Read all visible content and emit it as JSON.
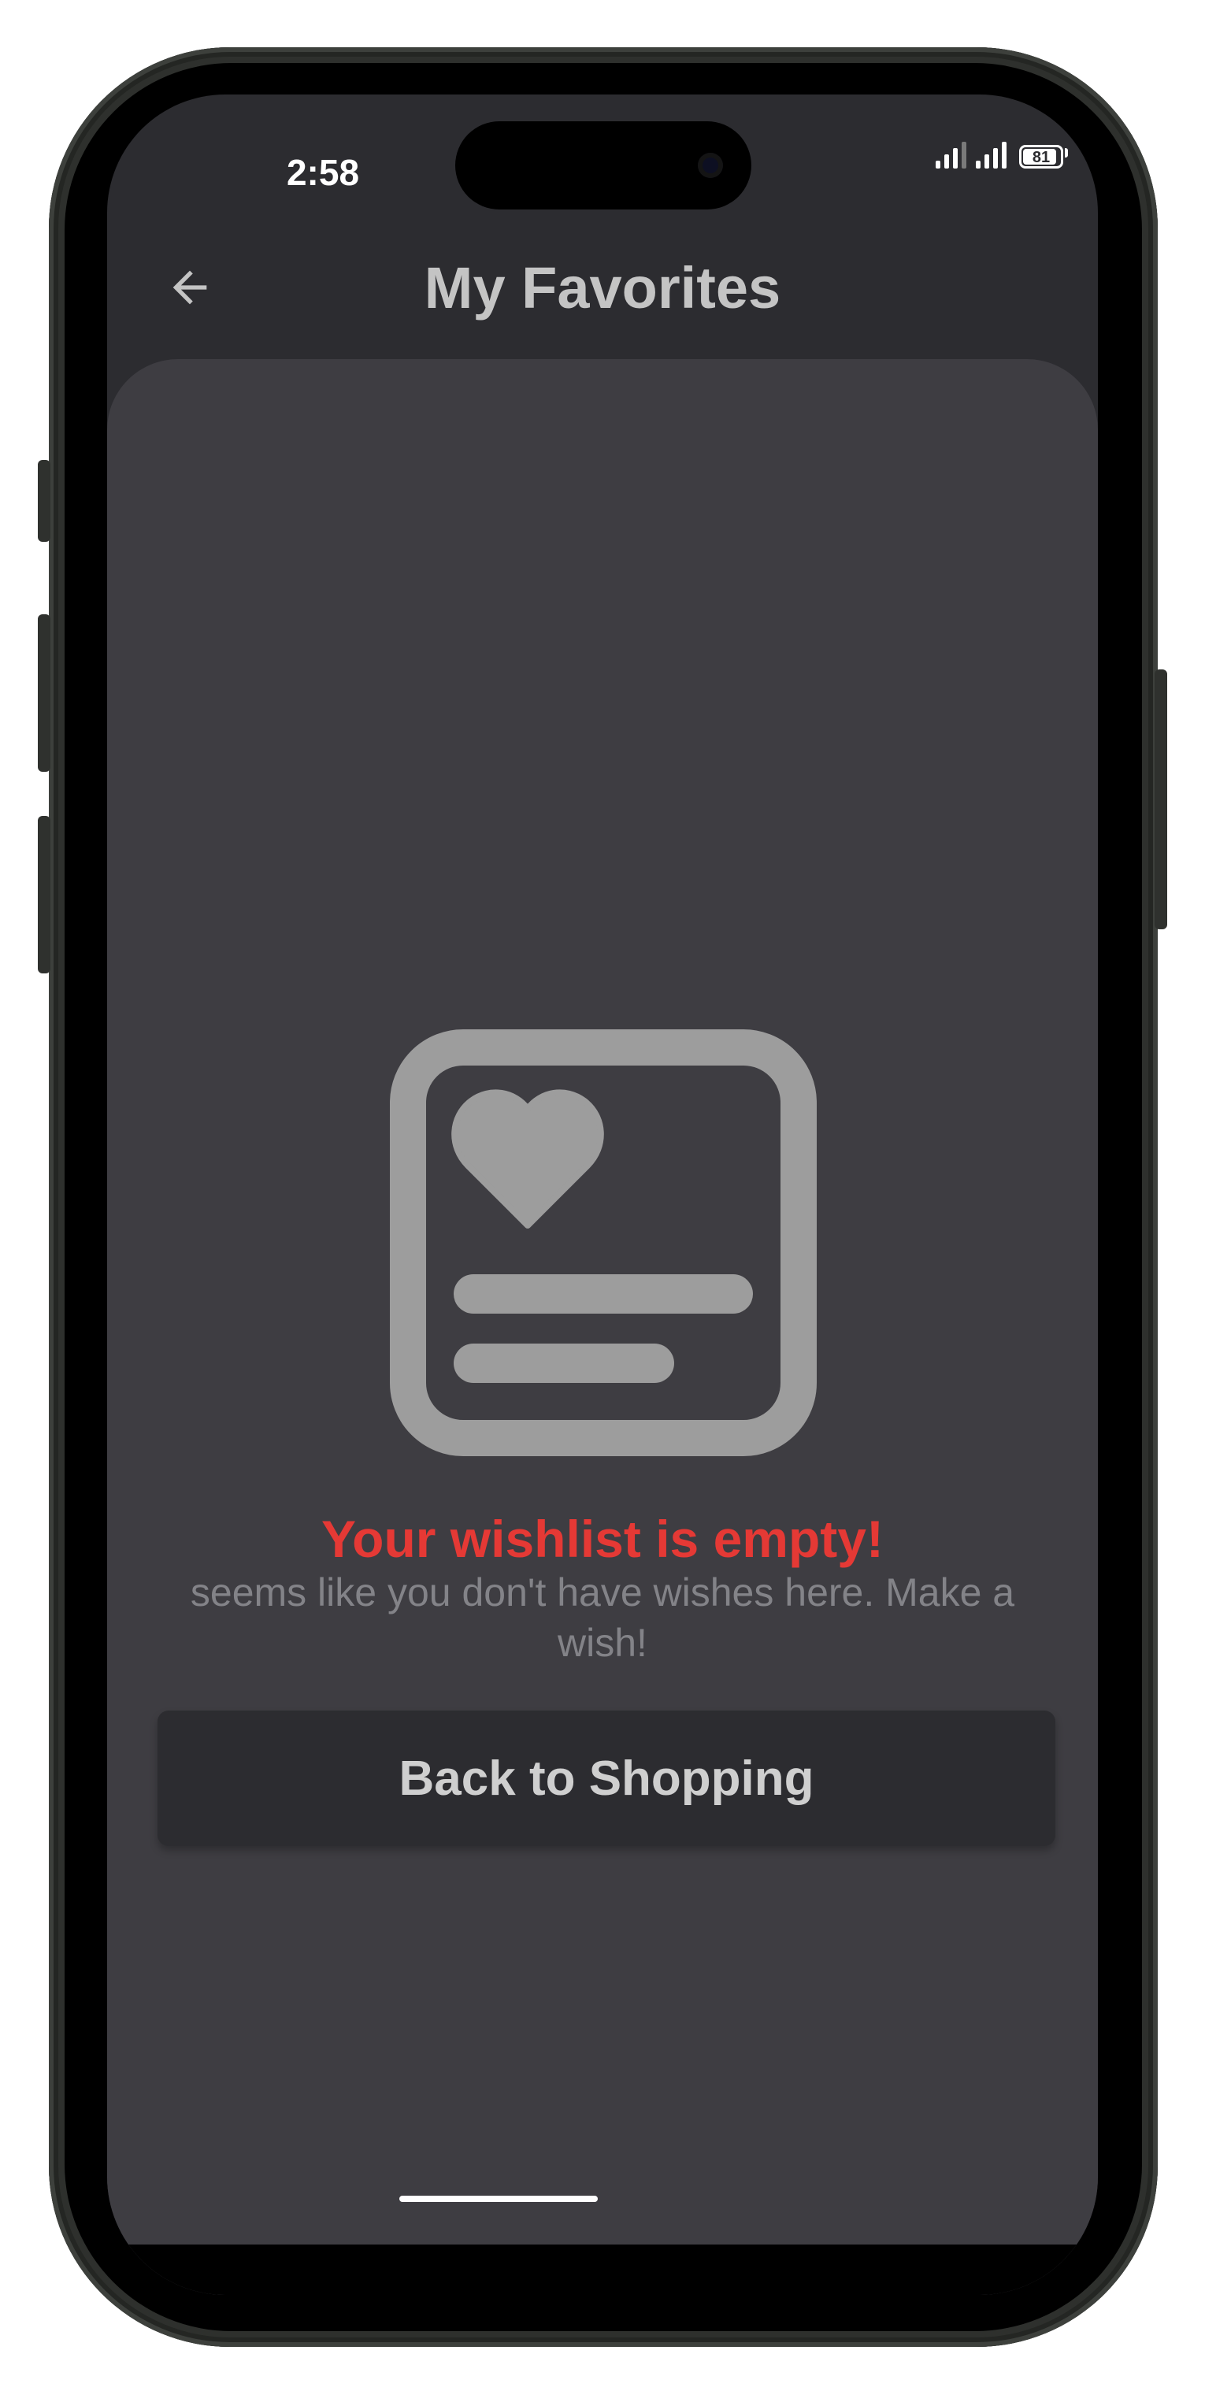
{
  "status_bar": {
    "time": "2:58",
    "battery": "81"
  },
  "header": {
    "title": "My Favorites",
    "back_icon": "arrow-left-icon"
  },
  "empty_state": {
    "icon": "wishlist-heart-icon",
    "title": "Your wishlist is empty!",
    "subtitle": "seems like you don't have wishes here. Make a wish!",
    "button_label": "Back to Shopping"
  },
  "colors": {
    "app_bar_bg": "#2c2c30",
    "content_bg": "#3e3d42",
    "title_accent": "#e53935",
    "icon_gray": "#9d9d9d",
    "button_bg": "#2c2c30"
  }
}
